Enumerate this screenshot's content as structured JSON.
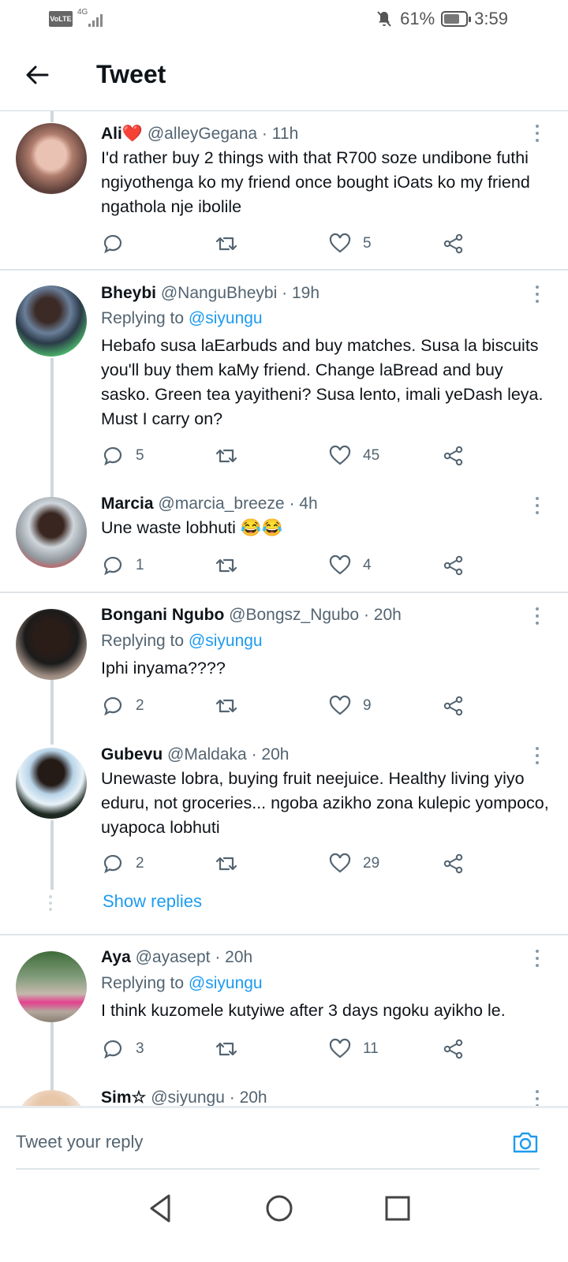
{
  "status_bar": {
    "volte": "VoLTE",
    "network": "4G",
    "battery_percent": "61%",
    "time": "3:59",
    "icons": [
      "volte-icon",
      "signal-icon",
      "mute-icon",
      "battery-icon"
    ]
  },
  "header": {
    "title": "Tweet",
    "back_icon": "arrow-left-icon"
  },
  "tweets": [
    {
      "name": "Ali❤️",
      "handle": "@alleyGegana",
      "time": "11h",
      "replying_to": "",
      "text": "I'd rather buy 2 things with that R700 soze undibone futhi ngiyothenga ko my friend once bought iOats ko my friend ngathola nje ibolile",
      "replies": "",
      "retweets": "",
      "likes": "5"
    },
    {
      "name": "Bheybi",
      "handle": "@NanguBheybi",
      "time": "19h",
      "replying_prefix": "Replying to",
      "replying_to": "@siyungu",
      "text": "Hebafo susa laEarbuds and buy matches. Susa la biscuits you'll buy them kaMy friend. Change laBread and buy sasko. Green tea yayitheni? Susa lento, imali yeDash leya. Must I carry on?",
      "replies": "5",
      "retweets": "",
      "likes": "45"
    },
    {
      "name": "Marcia",
      "handle": "@marcia_breeze",
      "time": "4h",
      "replying_to": "",
      "text": "Une waste lobhuti 😂😂",
      "replies": "1",
      "retweets": "",
      "likes": "4"
    },
    {
      "name": "Bongani Ngubo",
      "handle": "@Bongsz_Ngubo",
      "time": "20h",
      "replying_prefix": "Replying to",
      "replying_to": "@siyungu",
      "text": "Iphi inyama????",
      "replies": "2",
      "retweets": "",
      "likes": "9"
    },
    {
      "name": "Gubevu",
      "handle": "@Maldaka",
      "time": "20h",
      "replying_to": "",
      "text": "Unewaste lobra, buying fruit neejuice. Healthy living yiyo eduru, not groceries... ngoba azikho zona kulepic yompoco, uyapoca lobhuti",
      "replies": "2",
      "retweets": "",
      "likes": "29"
    },
    {
      "name": "Aya",
      "handle": "@ayasept",
      "time": "20h",
      "replying_prefix": "Replying to",
      "replying_to": "@siyungu",
      "text": "I think kuzomele kutyiwe after 3 days ngoku ayikho le.",
      "replies": "3",
      "retweets": "",
      "likes": "11"
    },
    {
      "name": "Sim☆",
      "handle": "@siyungu",
      "time": "20h"
    }
  ],
  "show_replies": "Show replies",
  "composer": {
    "placeholder": "Tweet your reply",
    "camera_icon": "camera-icon"
  },
  "navbar": {
    "icons": [
      "back-triangle-icon",
      "home-circle-icon",
      "recents-square-icon"
    ]
  },
  "colors": {
    "accent": "#1d9bf0",
    "secondary_text": "#536471",
    "divider": "#cfd9de"
  }
}
